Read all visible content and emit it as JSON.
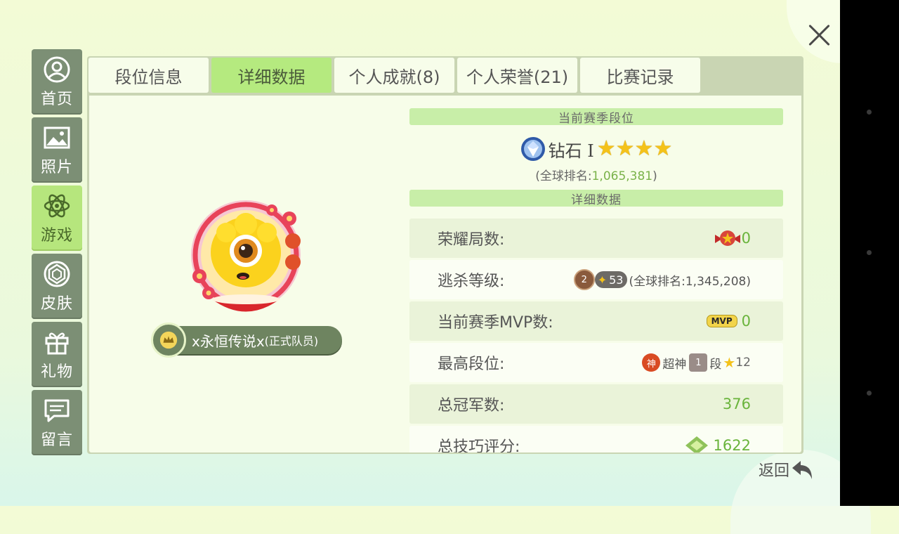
{
  "sidebar": {
    "items": [
      {
        "label": "首页",
        "icon": "profile-icon"
      },
      {
        "label": "照片",
        "icon": "photo-icon"
      },
      {
        "label": "游戏",
        "icon": "atom-icon",
        "active": true
      },
      {
        "label": "皮肤",
        "icon": "gem-icon"
      },
      {
        "label": "礼物",
        "icon": "gift-icon"
      },
      {
        "label": "留言",
        "icon": "message-icon"
      }
    ]
  },
  "tabs": [
    {
      "label": "段位信息"
    },
    {
      "label": "详细数据",
      "active": true
    },
    {
      "label": "个人成就(8)"
    },
    {
      "label": "个人荣誉(21)"
    },
    {
      "label": "比赛记录"
    }
  ],
  "player": {
    "name": "x永恒传说x",
    "role": "(正式队员)"
  },
  "season": {
    "header": "当前赛季段位",
    "rank_name": "钻石 I",
    "stars": 4,
    "global_rank_prefix": "(全球排名:",
    "global_rank_value": "1,065,381",
    "global_rank_suffix": ")"
  },
  "details": {
    "header": "详细数据",
    "rows": [
      {
        "label": "荣耀局数:",
        "value": "0"
      },
      {
        "label": "逃杀等级:",
        "level": "2",
        "pill_value": "53",
        "rank_text": "(全球排名:1,345,208)"
      },
      {
        "label": "当前赛季MVP数:",
        "badge": "MVP",
        "value": "0"
      },
      {
        "label": "最高段位:",
        "rank_a": "超神",
        "rank_b": "段",
        "star_count": "12"
      },
      {
        "label": "总冠军数:",
        "value": "376"
      },
      {
        "label": "总技巧评分:",
        "value": "1622"
      }
    ]
  },
  "footer": {
    "back_label": "返回"
  },
  "colors": {
    "accent": "#b5ea7f",
    "sidebar": "#7c8f75",
    "value_green": "#6ab43c"
  }
}
